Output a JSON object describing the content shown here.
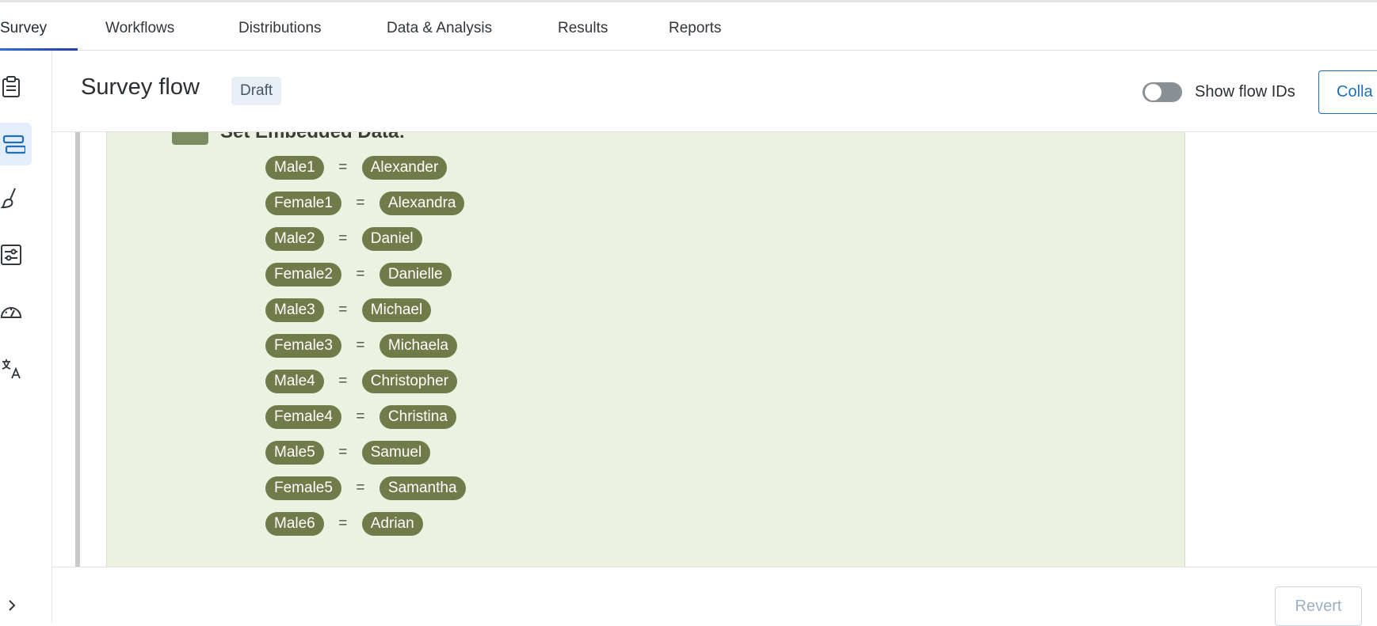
{
  "tabs": [
    {
      "label": "Survey",
      "active": true
    },
    {
      "label": "Workflows"
    },
    {
      "label": "Distributions"
    },
    {
      "label": "Data & Analysis"
    },
    {
      "label": "Results"
    },
    {
      "label": "Reports"
    }
  ],
  "sidebar": {
    "icons": [
      "clipboard-icon",
      "survey-flow-icon",
      "paintbrush-icon",
      "options-sliders-icon",
      "gauge-icon",
      "translate-icon"
    ],
    "active_icon": "survey-flow-icon"
  },
  "header": {
    "title": "Survey flow",
    "status_badge": "Draft",
    "toggle_label": "Show flow IDs",
    "toggle_on": false,
    "collapse_label": "Colla"
  },
  "block": {
    "title": "Set Embedded Data:",
    "rows": [
      {
        "field": "Male1",
        "value": "Alexander"
      },
      {
        "field": "Female1",
        "value": "Alexandra"
      },
      {
        "field": "Male2",
        "value": "Daniel"
      },
      {
        "field": "Female2",
        "value": "Danielle"
      },
      {
        "field": "Male3",
        "value": "Michael"
      },
      {
        "field": "Female3",
        "value": "Michaela"
      },
      {
        "field": "Male4",
        "value": "Christopher"
      },
      {
        "field": "Female4",
        "value": "Christina"
      },
      {
        "field": "Male5",
        "value": "Samuel"
      },
      {
        "field": "Female5",
        "value": "Samantha"
      },
      {
        "field": "Male6",
        "value": "Adrian"
      }
    ],
    "equals_sign": "="
  },
  "footer": {
    "revert_label": "Revert"
  },
  "colors": {
    "accent": "#1f6fb8",
    "block_bg": "#edf1e1",
    "pill_bg": "#717b4a",
    "tab_underline": "#2f6dd1"
  }
}
